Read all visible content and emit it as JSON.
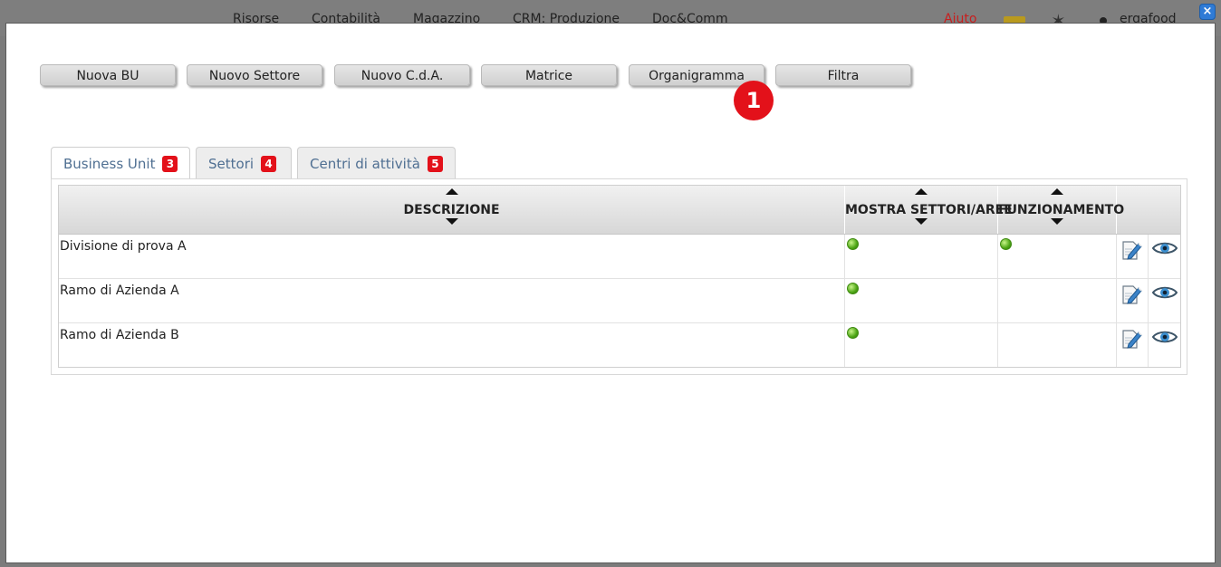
{
  "background_app": {
    "menu": [
      "Risorse",
      "Contabilità",
      "Magazzino",
      "CRM: Produzione",
      "Doc&Comm"
    ],
    "help_label": "Aiuto",
    "user_label": "ergafood"
  },
  "modal": {
    "close_label": "×",
    "toolbar": {
      "buttons": [
        "Nuova BU",
        "Nuovo Settore",
        "Nuovo C.d.A.",
        "Matrice",
        "Organigramma",
        "Filtra"
      ]
    },
    "callout_label": "1",
    "tabs": [
      {
        "label": "Business Unit",
        "badge": "3"
      },
      {
        "label": "Settori",
        "badge": "4"
      },
      {
        "label": "Centri di attività",
        "badge": "5"
      }
    ],
    "grid": {
      "columns": [
        "DESCRIZIONE",
        "MOSTRA SETTORI/AREE",
        "FUNZIONAMENTO"
      ],
      "rows": [
        {
          "descrizione": "Divisione di prova A",
          "mostra_settori": true,
          "funzionamento": true
        },
        {
          "descrizione": "Ramo di Azienda A",
          "mostra_settori": true,
          "funzionamento": false
        },
        {
          "descrizione": "Ramo di Azienda B",
          "mostra_settori": true,
          "funzionamento": false
        }
      ]
    }
  },
  "icons": {
    "edit": "edit-icon",
    "view": "eye-icon",
    "status": "green-status-dot"
  },
  "colors": {
    "accent_red": "#e3111a",
    "tab_text": "#4f6f92",
    "status_green": "#4da515"
  }
}
